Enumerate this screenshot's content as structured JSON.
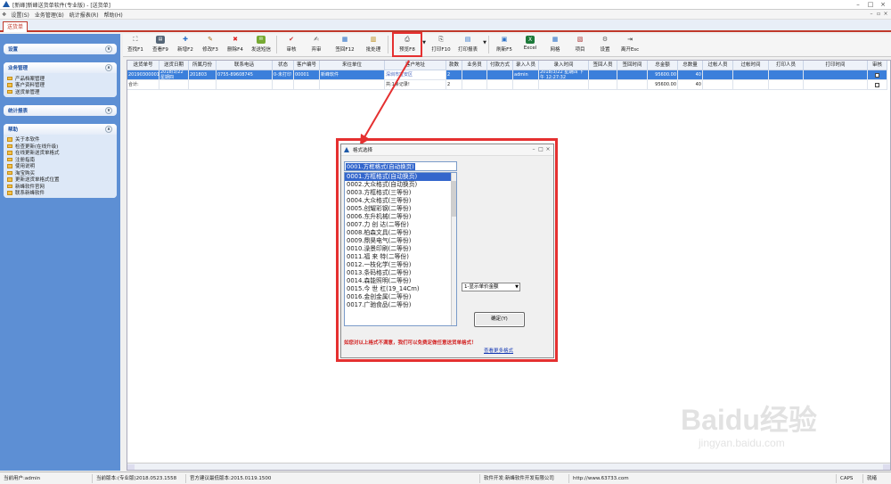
{
  "window": {
    "title": "[新峰]新峰送货单软件(专业版) - [送货单]"
  },
  "menu": {
    "items": [
      "设置(S)",
      "业务管理(B)",
      "统计报表(R)",
      "帮助(H)"
    ]
  },
  "tabs": [
    "送货单"
  ],
  "sidebar": {
    "settings": {
      "title": "设置"
    },
    "business": {
      "title": "业务管理",
      "items": [
        "产品档案管理",
        "客户资料管理",
        "送货单管理"
      ]
    },
    "reports": {
      "title": "统计报表"
    },
    "help": {
      "title": "帮助",
      "items": [
        "关于本软件",
        "检查更新(在线升级)",
        "在线更新送货单格式",
        "注册指南",
        "使用说明",
        "淘宝购买",
        "更新送货单格式位置",
        "新峰软件官网",
        "联系新峰软件"
      ]
    }
  },
  "toolbar": {
    "buttons": [
      {
        "label": "查找F1",
        "icon": "binoculars-icon"
      },
      {
        "label": "查看F9",
        "icon": "view-icon"
      },
      {
        "label": "新增F2",
        "icon": "new-icon"
      },
      {
        "label": "修改F3",
        "icon": "edit-icon"
      },
      {
        "label": "删除F4",
        "icon": "delete-icon"
      },
      {
        "label": "发送短信",
        "icon": "sms-icon"
      },
      {
        "label": "审核",
        "icon": "check-icon"
      },
      {
        "label": "弃审",
        "icon": "unaudit-icon"
      },
      {
        "label": "签回F12",
        "icon": "signback-icon"
      },
      {
        "label": "批处理",
        "icon": "batch-icon"
      },
      {
        "label": "预览F8",
        "icon": "preview-icon"
      },
      {
        "label": "打印F10",
        "icon": "print-icon"
      },
      {
        "label": "打印报表",
        "icon": "report-icon"
      },
      {
        "label": "刷新F5",
        "icon": "refresh-icon"
      },
      {
        "label": "Excel",
        "icon": "excel-icon"
      },
      {
        "label": "网格",
        "icon": "grid-icon"
      },
      {
        "label": "项目",
        "icon": "project-icon"
      },
      {
        "label": "设置",
        "icon": "settings-icon"
      },
      {
        "label": "离开Esc",
        "icon": "exit-icon"
      }
    ]
  },
  "grid": {
    "columns": [
      "送货单号",
      "送货日期",
      "所属月份",
      "联系电话",
      "状态",
      "客户编号",
      "来往单位",
      "客户地址",
      "款数",
      "业务员",
      "付款方式",
      "录入人员",
      "录入时间",
      "签回人员",
      "签回时间",
      "总金额",
      "总数量",
      "过帐人员",
      "过帐时间",
      "打印人员",
      "打印时间",
      "审核"
    ],
    "rows": [
      [
        "20190300001",
        "2018/3/22 星期四",
        "201803",
        "0755-89608745",
        "0-未打印",
        "00001",
        "新峰软件",
        "深圳市宝安区",
        "2",
        "",
        "",
        "admin",
        "2018/3/22 星期四 下午 12:27:32",
        "",
        "",
        "95600.00",
        "40",
        "",
        "",
        "",
        "",
        ""
      ]
    ],
    "total": {
      "label": "合计:",
      "records": "共:1条记录!",
      "count": "2",
      "amount": "95600.00",
      "qty": "40"
    }
  },
  "dialog": {
    "title": "格式选择",
    "selected": "0001.方框格式(自动换页)",
    "options": [
      "0001.方框格式(自动换页)",
      "0002.大众格式(自动换页)",
      "0003.方框格式(三等份)",
      "0004.大众格式(三等份)",
      "0005.创耀彩钢(二等份)",
      "0006.东升机械(二等份)",
      "0007.力 创 达(二等份)",
      "0008.柏森文具(二等份)",
      "0009.鼎昊电气(二等份)",
      "0010.澡景印刷(二等份)",
      "0011.福 来 特(二等份)",
      "0012.一枝化学(三等份)",
      "0013.条码格式(二等份)",
      "0014.森能照明(二等份)",
      "0015.今 世 杠(19_14Cm)",
      "0016.金创金属(二等份)",
      "0017.广驰食品(二等份)"
    ],
    "price_option": "1-显示单价金额",
    "ok_label": "确定(Y)",
    "notice": "如您对以上格式不满意，我们可以免费定做任意送货单格式！",
    "more_link": "查看更多格式"
  },
  "status": {
    "user": "当前用户:admin",
    "version": "当前版本:(专业版)2018.0523.1558",
    "recommend": "官方建议最低版本:2015.0119.1500",
    "dev": "软件开发:新峰软件开发有限公司",
    "site": "http://www.63733.com",
    "caps": "CAPS",
    "ime": "就绪"
  },
  "watermark": {
    "brand": "Baidu经验",
    "url": "jingyan.baidu.com"
  },
  "colors": {
    "accent": "#3b7fdb",
    "highlight": "#e53030",
    "sidebar": "#5d8fd4"
  }
}
